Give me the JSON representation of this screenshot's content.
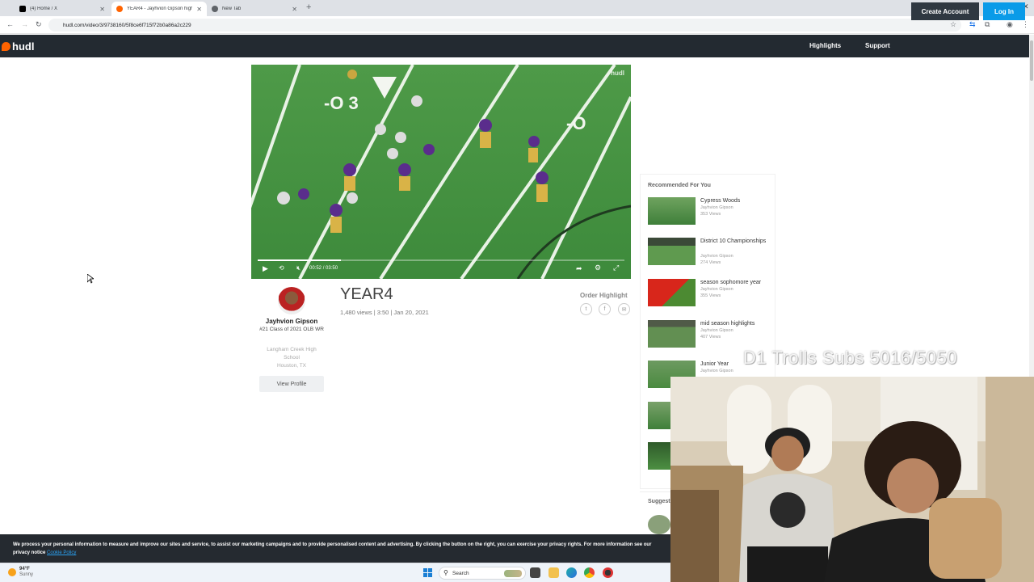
{
  "browser": {
    "tabs": [
      {
        "title": "(4) Home / X",
        "active": false
      },
      {
        "title": "YEAR4 - Jayhvion Gipson highlights",
        "active": true
      },
      {
        "title": "New Tab",
        "active": false
      }
    ],
    "url": "hudl.com/video/3/9738160/5f8ce6f715f72b0a86a2c229"
  },
  "header": {
    "logo": "hudl",
    "nav": {
      "highlights": "Highlights",
      "support": "Support",
      "create_account": "Create Account",
      "log_in": "Log In"
    },
    "colors": {
      "bar": "#232a31",
      "accent": "#ff6300",
      "login": "#0a9be8"
    }
  },
  "video": {
    "watermark": "hudl",
    "time_current": "00:52",
    "time_separator": "/",
    "time_total": "03:50",
    "progress_fraction": 0.226
  },
  "athlete": {
    "name": "Jayhvion Gipson",
    "class_line": "#21 Class of 2021 OLB WR",
    "school": "Langham Creek High School",
    "location": "Houston, TX",
    "view_profile": "View Profile"
  },
  "details": {
    "title": "YEAR4",
    "meta": "1,480 views | 3:50 | Jan 20, 2021",
    "order_highlight": "Order Highlight"
  },
  "recommended": {
    "heading": "Recommended For You",
    "items": [
      {
        "title": "Cypress Woods",
        "author": "Jayhvion Gipson",
        "views": "353 Views"
      },
      {
        "title": "District 10 Championships",
        "author": "Jayhvion Gipson",
        "views": "274 Views"
      },
      {
        "title": "season sophomore year",
        "author": "Jayhvion Gipson",
        "views": "355 Views"
      },
      {
        "title": "mid season highlights",
        "author": "Jayhvion Gipson",
        "views": "407 Views"
      },
      {
        "title": "Junior Year",
        "author": "Jayhvion Gipson",
        "views": ""
      }
    ],
    "suggest_heading": "Suggest"
  },
  "cookie": {
    "text": "We process your personal information to measure and improve our sites and service, to assist our marketing campaigns and to provide personalised content and advertising. By clicking the button on the right, you can exercise your privacy rights. For more information see our privacy notice",
    "link": "Cookie Policy"
  },
  "taskbar": {
    "temperature": "94°F",
    "condition": "Sunny",
    "search": "Search"
  },
  "stream_overlay": {
    "text": "D1 Trolls Subs 5016/5050"
  }
}
